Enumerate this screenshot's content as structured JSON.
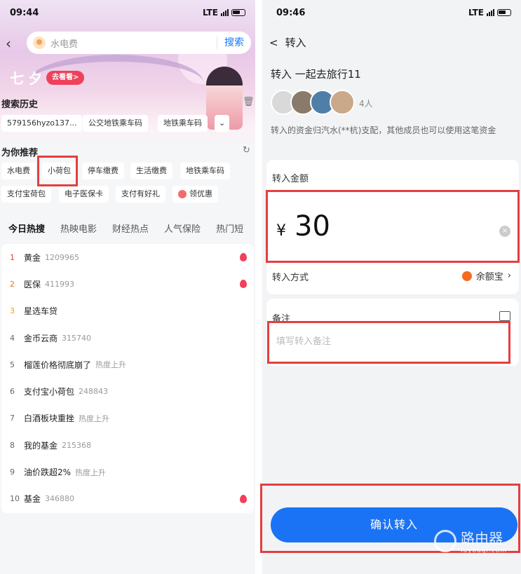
{
  "left": {
    "status": {
      "time": "09:44",
      "network": "LTE"
    },
    "search": {
      "placeholder": "水电费",
      "button": "搜索"
    },
    "banner": {
      "festival": "七夕",
      "look_button": "去看看>"
    },
    "history": {
      "title": "搜索历史",
      "items": [
        "579156hyzo137...",
        "公交地铁乘车码",
        "地铁乘车码"
      ]
    },
    "recommend": {
      "title": "为你推荐",
      "row1": [
        "水电费",
        "小荷包",
        "停车缴费",
        "生活缴费",
        "地铁乘车码"
      ],
      "row2": [
        "支付宝荷包",
        "电子医保卡",
        "支付有好礼",
        "领优惠"
      ]
    },
    "tabs": [
      "今日热搜",
      "热映电影",
      "财经热点",
      "人气保险",
      "热门短"
    ],
    "hot": [
      {
        "rank": "1",
        "title": "黄金",
        "meta": "1209965",
        "fire": true
      },
      {
        "rank": "2",
        "title": "医保",
        "meta": "411993",
        "fire": true
      },
      {
        "rank": "3",
        "title": "星选车贷",
        "meta": "",
        "fire": false
      },
      {
        "rank": "4",
        "title": "金币云商",
        "meta": "315740",
        "fire": false
      },
      {
        "rank": "5",
        "title": "榴莲价格彻底崩了",
        "meta": "热度上升",
        "fire": false
      },
      {
        "rank": "6",
        "title": "支付宝小荷包",
        "meta": "248843",
        "fire": false
      },
      {
        "rank": "7",
        "title": "白酒板块重挫",
        "meta": "热度上升",
        "fire": false
      },
      {
        "rank": "8",
        "title": "我的基金",
        "meta": "215368",
        "fire": false
      },
      {
        "rank": "9",
        "title": "油价跌超2%",
        "meta": "热度上升",
        "fire": false
      },
      {
        "rank": "10",
        "title": "基金",
        "meta": "346880",
        "fire": true
      }
    ]
  },
  "right": {
    "status": {
      "time": "09:46",
      "network": "LTE"
    },
    "header": {
      "back": "<",
      "title": "转入"
    },
    "target": "转入 一起去旅行11",
    "members": "4人",
    "description": "转入的资金归汽水(**杭)支配，其他成员也可以使用这笔资金",
    "amount_label": "转入金额",
    "currency": "¥",
    "amount": "30",
    "clear": "×",
    "method_label": "转入方式",
    "method_value": "余额宝",
    "note_label": "备注",
    "note_placeholder": "填写转入备注",
    "confirm": "确认转入"
  },
  "watermark": {
    "text": "路由器",
    "sub": "luyouqi.com"
  },
  "colors": {
    "accent": "#1a73f5",
    "highlight_box": "#e53e3e",
    "hot_red": "#f0405a"
  }
}
